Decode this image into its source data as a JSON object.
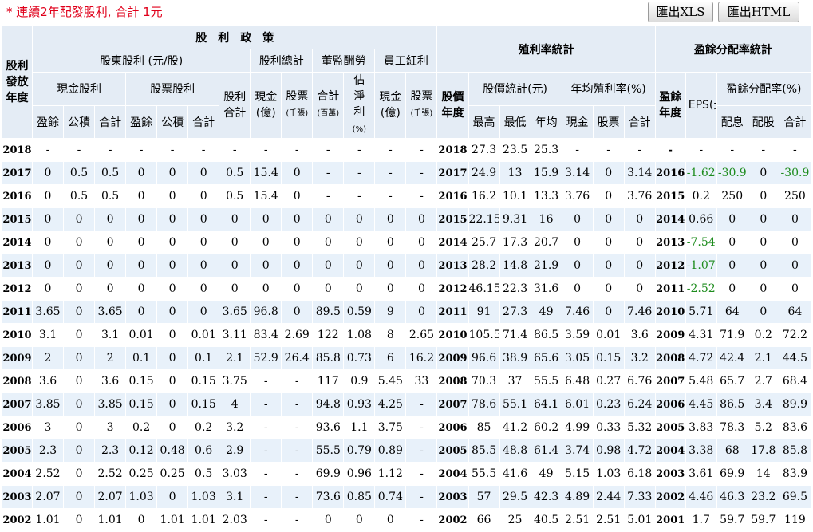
{
  "note": "* 連續2年配發股利, 合計 1元",
  "toolbar": {
    "xls_label": "匯出XLS",
    "html_label": "匯出HTML"
  },
  "headers": {
    "dividend_policy": "股　利　政　策",
    "yield_stats": "殖利率統計",
    "payout_stats": "盈餘分配率統計",
    "issue_year": "股利發放年度",
    "shareholder_dividend": "股東股利 (元/股)",
    "dividend_total": "股利總計",
    "director_pay": "董監酬勞",
    "employee_bonus": "員工紅利",
    "cash_dividend": "現金股利",
    "stock_dividend": "股票股利",
    "div_sum": "股利合計",
    "cash_100m": "現金(億)",
    "stock_k": "股票",
    "stock_k_unit": "(千張)",
    "dir_total": "合計",
    "dir_total_unit": "(百萬)",
    "pct_of_net": "佔淨利",
    "pct_unit": "(%)",
    "emp_cash": "現金(億)",
    "emp_stock": "股票",
    "emp_stock_unit": "(千張)",
    "price_year": "股價年度",
    "price_stats": "股價統計(元)",
    "avg_yield": "年均殖利率(%)",
    "earn_year": "盈餘年度",
    "eps": "EPS(元)",
    "payout_ratio": "盈餘分配率(%)",
    "earnings": "盈餘",
    "reserve": "公積",
    "sum": "合計",
    "high": "最高",
    "low": "最低",
    "avg": "年均",
    "cash": "現金",
    "stock": "股票",
    "pay_cash": "配息",
    "pay_stock": "配股"
  },
  "rows": [
    [
      "2018",
      "-",
      "-",
      "-",
      "-",
      "-",
      "-",
      "-",
      "-",
      "-",
      "-",
      "-",
      "-",
      "-",
      "2018",
      "27.3",
      "23.5",
      "25.3",
      "-",
      "-",
      "-",
      "-",
      "-",
      "-",
      "-",
      "-"
    ],
    [
      "2017",
      "0",
      "0.5",
      "0.5",
      "0",
      "0",
      "0",
      "0.5",
      "15.4",
      "0",
      "-",
      "-",
      "-",
      "-",
      "2017",
      "24.9",
      "13",
      "15.9",
      "3.14",
      "0",
      "3.14",
      "2016",
      "-1.62",
      "-30.9",
      "0",
      "-30.9"
    ],
    [
      "2016",
      "0",
      "0.5",
      "0.5",
      "0",
      "0",
      "0",
      "0.5",
      "15.4",
      "0",
      "-",
      "-",
      "-",
      "-",
      "2016",
      "16.2",
      "10.1",
      "13.3",
      "3.76",
      "0",
      "3.76",
      "2015",
      "0.2",
      "250",
      "0",
      "250"
    ],
    [
      "2015",
      "0",
      "0",
      "0",
      "0",
      "0",
      "0",
      "0",
      "0",
      "0",
      "0",
      "0",
      "0",
      "0",
      "2015",
      "22.15",
      "9.31",
      "16",
      "0",
      "0",
      "0",
      "2014",
      "0.66",
      "0",
      "0",
      "0"
    ],
    [
      "2014",
      "0",
      "0",
      "0",
      "0",
      "0",
      "0",
      "0",
      "0",
      "0",
      "0",
      "0",
      "0",
      "0",
      "2014",
      "25.7",
      "17.3",
      "20.7",
      "0",
      "0",
      "0",
      "2013",
      "-7.54",
      "0",
      "0",
      "0"
    ],
    [
      "2013",
      "0",
      "0",
      "0",
      "0",
      "0",
      "0",
      "0",
      "0",
      "0",
      "0",
      "0",
      "0",
      "0",
      "2013",
      "28.2",
      "14.8",
      "21.9",
      "0",
      "0",
      "0",
      "2012",
      "-1.07",
      "0",
      "0",
      "0"
    ],
    [
      "2012",
      "0",
      "0",
      "0",
      "0",
      "0",
      "0",
      "0",
      "0",
      "0",
      "0",
      "0",
      "0",
      "0",
      "2012",
      "46.15",
      "22.3",
      "31.6",
      "0",
      "0",
      "0",
      "2011",
      "-2.52",
      "0",
      "0",
      "0"
    ],
    [
      "2011",
      "3.65",
      "0",
      "3.65",
      "0",
      "0",
      "0",
      "3.65",
      "96.8",
      "0",
      "89.5",
      "0.59",
      "9",
      "0",
      "2011",
      "91",
      "27.3",
      "49",
      "7.46",
      "0",
      "7.46",
      "2010",
      "5.71",
      "64",
      "0",
      "64"
    ],
    [
      "2010",
      "3.1",
      "0",
      "3.1",
      "0.01",
      "0",
      "0.01",
      "3.11",
      "83.4",
      "2.69",
      "122",
      "1.08",
      "8",
      "2.65",
      "2010",
      "105.5",
      "71.4",
      "86.5",
      "3.59",
      "0.01",
      "3.6",
      "2009",
      "4.31",
      "71.9",
      "0.2",
      "72.2"
    ],
    [
      "2009",
      "2",
      "0",
      "2",
      "0.1",
      "0",
      "0.1",
      "2.1",
      "52.9",
      "26.4",
      "85.8",
      "0.73",
      "6",
      "16.2",
      "2009",
      "96.6",
      "38.9",
      "65.6",
      "3.05",
      "0.15",
      "3.2",
      "2008",
      "4.72",
      "42.4",
      "2.1",
      "44.5"
    ],
    [
      "2008",
      "3.6",
      "0",
      "3.6",
      "0.15",
      "0",
      "0.15",
      "3.75",
      "-",
      "-",
      "117",
      "0.9",
      "5.45",
      "33",
      "2008",
      "70.3",
      "37",
      "55.5",
      "6.48",
      "0.27",
      "6.76",
      "2007",
      "5.48",
      "65.7",
      "2.7",
      "68.4"
    ],
    [
      "2007",
      "3.85",
      "0",
      "3.85",
      "0.15",
      "0",
      "0.15",
      "4",
      "-",
      "-",
      "94.8",
      "0.93",
      "4.25",
      "-",
      "2007",
      "78.6",
      "55.1",
      "64.1",
      "6.01",
      "0.23",
      "6.24",
      "2006",
      "4.45",
      "86.5",
      "3.4",
      "89.9"
    ],
    [
      "2006",
      "3",
      "0",
      "3",
      "0.2",
      "0",
      "0.2",
      "3.2",
      "-",
      "-",
      "93.6",
      "1.1",
      "3.75",
      "-",
      "2006",
      "85",
      "41.2",
      "60.2",
      "4.99",
      "0.33",
      "5.32",
      "2005",
      "3.83",
      "78.3",
      "5.2",
      "83.6"
    ],
    [
      "2005",
      "2.3",
      "0",
      "2.3",
      "0.12",
      "0.48",
      "0.6",
      "2.9",
      "-",
      "-",
      "55.5",
      "0.79",
      "0.89",
      "-",
      "2005",
      "85.5",
      "48.8",
      "61.4",
      "3.74",
      "0.98",
      "4.72",
      "2004",
      "3.38",
      "68",
      "17.8",
      "85.8"
    ],
    [
      "2004",
      "2.52",
      "0",
      "2.52",
      "0.25",
      "0.25",
      "0.5",
      "3.03",
      "-",
      "-",
      "69.9",
      "0.96",
      "1.12",
      "-",
      "2004",
      "55.5",
      "41.6",
      "49",
      "5.15",
      "1.03",
      "6.18",
      "2003",
      "3.61",
      "69.9",
      "14",
      "83.9"
    ],
    [
      "2003",
      "2.07",
      "0",
      "2.07",
      "1.03",
      "0",
      "1.03",
      "3.1",
      "-",
      "-",
      "73.6",
      "0.85",
      "0.74",
      "-",
      "2003",
      "57",
      "29.5",
      "42.3",
      "4.89",
      "2.44",
      "7.33",
      "2002",
      "4.46",
      "46.3",
      "23.2",
      "69.5"
    ],
    [
      "2002",
      "1.01",
      "0",
      "1.01",
      "0",
      "1.01",
      "1.01",
      "2.03",
      "-",
      "-",
      "0",
      "0",
      "0",
      "-",
      "2002",
      "66",
      "25",
      "40.5",
      "2.51",
      "2.51",
      "5.01",
      "2001",
      "1.7",
      "59.7",
      "59.7",
      "119"
    ]
  ],
  "colors": {
    "header_bg": "#e4ecf5",
    "row_alt": "#e8f1fa",
    "note": "#e0001b",
    "negative": "#1e8c1e"
  }
}
